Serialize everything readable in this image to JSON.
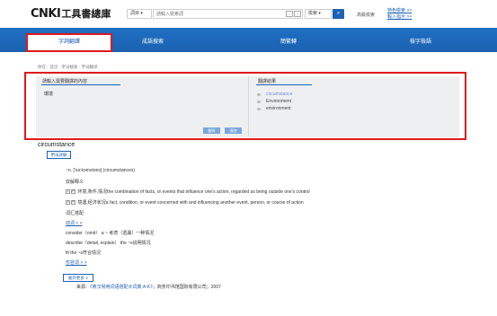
{
  "header": {
    "logo_mark": "CNKI",
    "logo_text": "工具書總庫",
    "scope_select": "詞目 ▾",
    "search_placeholder": "請輸入檢索詞",
    "pager_prev": "‹",
    "pager_next": "›",
    "field_select": "檢索 ▾",
    "search_button": "⌕",
    "advanced_search": "高級檢索",
    "link_1": "特色檢索 >>",
    "link_2": "輸入指示 >>"
  },
  "tabs": [
    {
      "label": "字詞翻譯",
      "active": true
    },
    {
      "label": "成語搜索",
      "active": false
    },
    {
      "label": "簡繁轉",
      "active": false
    },
    {
      "label": "檢字檢語",
      "active": false
    }
  ],
  "breadcrumb": "你在：首页 · 字词搜索 · 字词翻译",
  "translate_panel": {
    "source_heading": "請輸入需要翻譯的內容",
    "source_text": "環境",
    "clear_button": "翻译",
    "translate_button": "清除",
    "result_heading": "翻譯結果",
    "results": [
      "circumstance",
      "Environment",
      "environment"
    ]
  },
  "entry": {
    "word": "circumstance",
    "detail_button": "用法詳解",
    "line_pos": "~n. ['sə:kəmstəns] (circumstances)",
    "line_def_title": "双解释义",
    "def_1_num": "1",
    "def_1_tag": "P",
    "def_1": "环境,条件,情况the combination of facts, or events that influence one's action, regarded as being outside one's control",
    "def_2_num": "2",
    "def_2_tag": "P",
    "def_2": "境遇,经济状况a fact, condition, or event concerned with and influencing another event, person, or course of action",
    "collocation_title": "词汇搭配",
    "verb_link": "动词 < <",
    "colloc_1": "consider（omit） a ~ 考虑（遗漏）一种情况",
    "colloc_2": "describe（detail, explain） the ~s说明情况",
    "colloc_3": "fit the ~s符合情况",
    "adj_link": "形容词 > >",
    "more_button": "展开更多 ∨",
    "source_prefix": "来源：",
    "source_book": "《英汉常用词语搭配大词典 A-K》",
    "source_suffix": "；商务印书馆国际有限公司；2007"
  }
}
